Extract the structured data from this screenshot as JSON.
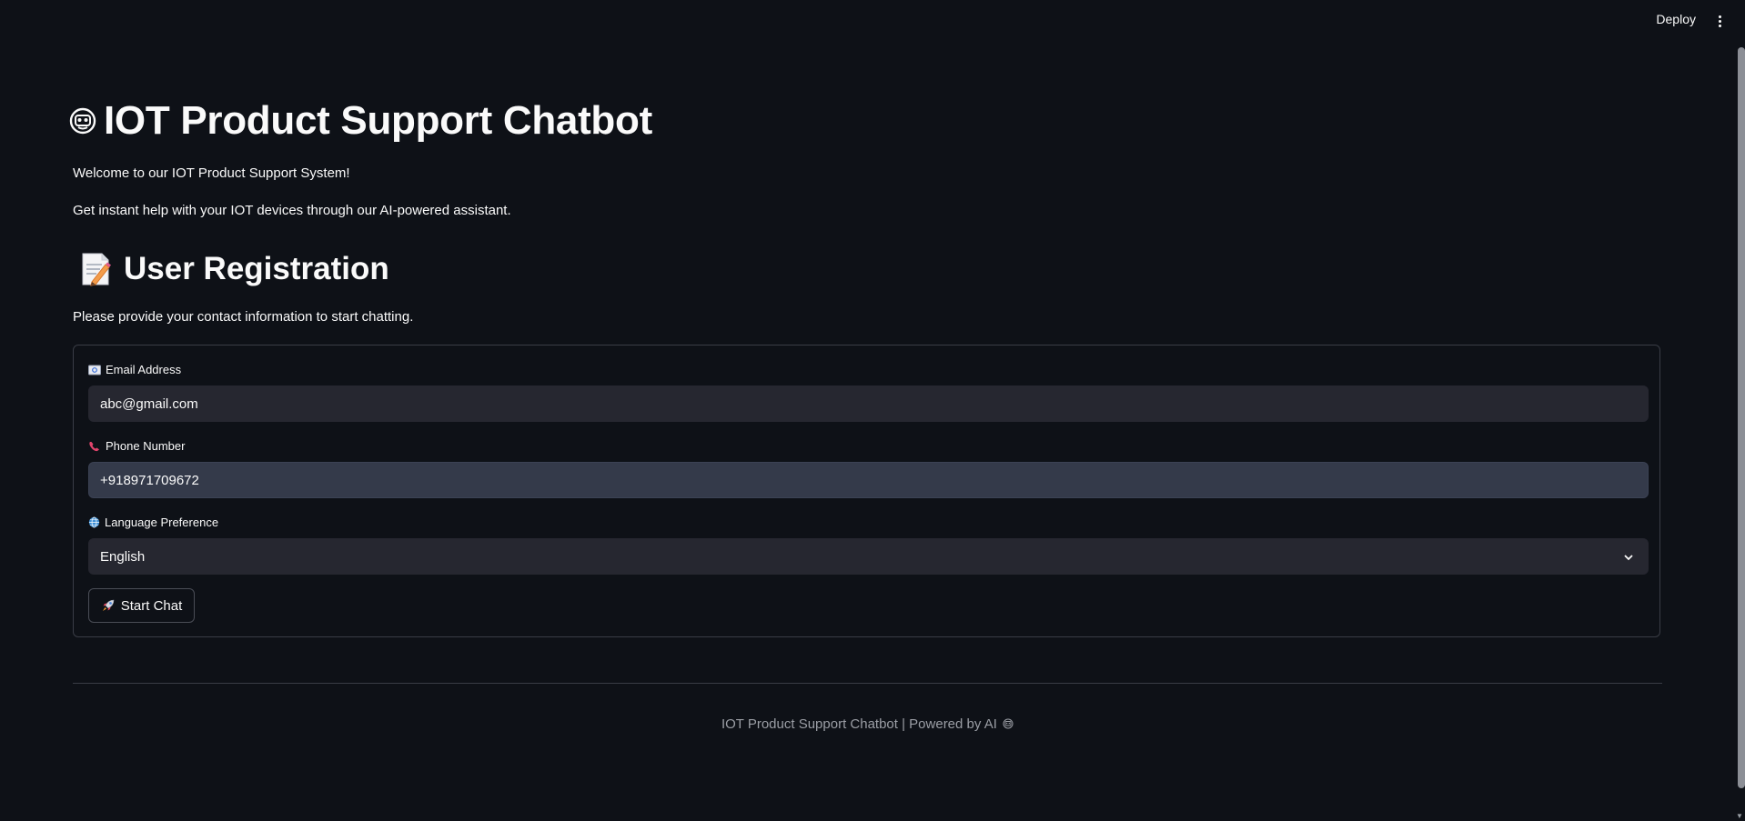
{
  "header": {
    "deploy_label": "Deploy",
    "menu_icon": "vertical-ellipsis-icon"
  },
  "page": {
    "title": "IOT Product Support Chatbot",
    "title_icon": "robot-face-icon",
    "welcome": "Welcome to our IOT Product Support System!",
    "subtitle": "Get instant help with your IOT devices through our AI-powered assistant."
  },
  "registration": {
    "heading": "User Registration",
    "heading_icon": "memo-icon",
    "instructions": "Please provide your contact information to start chatting.",
    "email": {
      "icon": "email-envelope-icon",
      "label": "Email Address",
      "value": "abc@gmail.com"
    },
    "phone": {
      "icon": "telephone-receiver-icon",
      "label": "Phone Number",
      "value": "+918971709672"
    },
    "language": {
      "icon": "globe-icon",
      "label": "Language Preference",
      "selected": "English"
    },
    "start_button": {
      "icon": "rocket-icon",
      "label": "Start Chat"
    }
  },
  "footer": {
    "text": "IOT Product Support Chatbot | Powered by AI",
    "icon": "robot-face-icon"
  },
  "colors": {
    "background": "#0e1117",
    "input_background": "#262730",
    "input_focused_background": "#343a4a",
    "text": "#fafafa",
    "muted_text": "#9b9ea5",
    "border": "#3a3d46"
  }
}
